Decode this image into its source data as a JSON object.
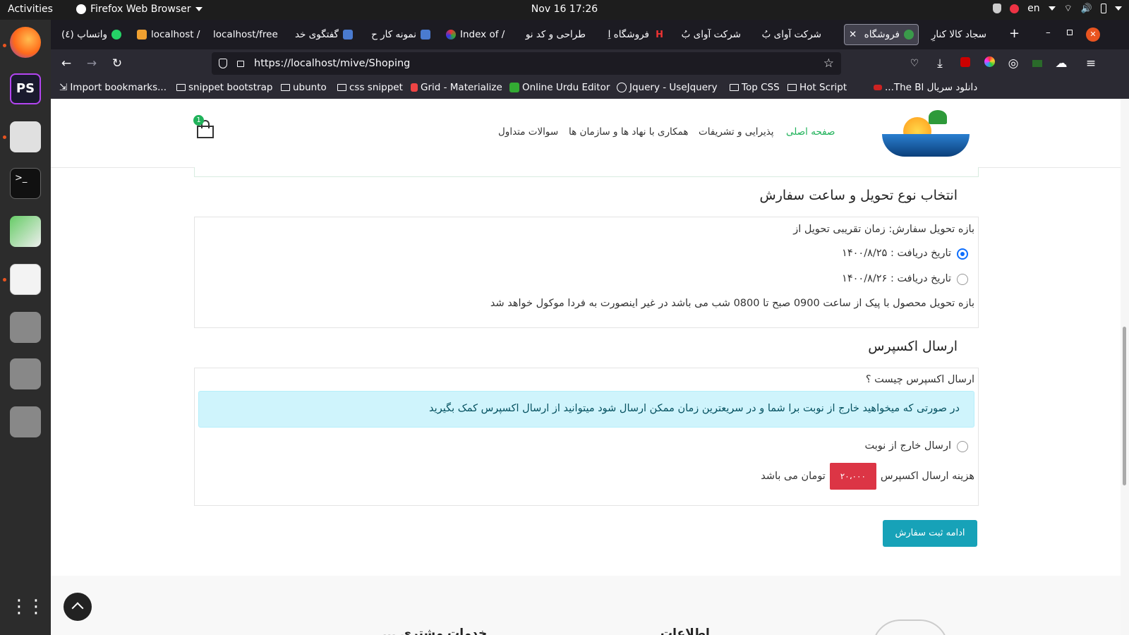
{
  "os": {
    "activities": "Activities",
    "app_name": "Firefox Web Browser",
    "clock": "Nov 16  17:26",
    "lang": "en"
  },
  "browser": {
    "tabs": [
      {
        "label": "واتساپ (٤)"
      },
      {
        "label": "localhost /"
      },
      {
        "label": "localhost/free"
      },
      {
        "label": "گفتگوی خد"
      },
      {
        "label": "نمونه کار ح"
      },
      {
        "label": "Index of /"
      },
      {
        "label": "طراحی و کد نو"
      },
      {
        "label": "فروشگاه اِ"
      },
      {
        "label": "شرکت آوای بُ"
      },
      {
        "label": "شرکت آوای بُ"
      },
      {
        "label": "فروشگاه"
      },
      {
        "label": "سجاد کالا کنارِ"
      }
    ],
    "new_tab": "+",
    "url": "https://localhost/mive/Shoping",
    "bookmarks": [
      "Import bookmarks...",
      "snippet bootstrap",
      "ubunto",
      "css snippet",
      "Grid - Materialize",
      "Online Urdu Editor",
      "Jquery - UseJquery",
      "Top CSS",
      "Hot Script",
      "دانلود سریال The Bl..."
    ]
  },
  "site": {
    "cart_count": "1",
    "menu": [
      {
        "label": "صفحه اصلی"
      },
      {
        "label": "پذیرایی و تشریفات"
      },
      {
        "label": "همکاری با نهاد ها و سازمان ها"
      },
      {
        "label": "سوالات متداول"
      }
    ]
  },
  "delivery": {
    "title": "انتخاب نوع تحویل و ساعت سفارش",
    "range_label": "بازه تحویل سفارش: زمان تقریبی تحویل از",
    "options": [
      {
        "label": "تاریخ دریافت : ۱۴۰۰/۸/۲۵",
        "checked": true
      },
      {
        "label": "تاریخ دریافت : ۱۴۰۰/۸/۲۶",
        "checked": false
      }
    ],
    "note": "بازه تحویل محصول با پیک از ساعت 0900 صبح تا 0800 شب می باشد در غیر اینصورت به فردا موکول خواهد شد"
  },
  "express": {
    "title": "ارسال اکسپرس",
    "question": "ارسال اکسپرس چیست ؟",
    "info": "در صورتی که میخواهید خارج از نوبت برا شما و در سریعترین زمان ممکن ارسال شود میتوانید از ارسال اکسپرس کمک بگیرید",
    "option": "ارسال خارج از نوبت",
    "cost_prefix": "هزینه ارسال اکسپرس",
    "cost_value": "۲۰،۰۰۰",
    "cost_suffix": "تومان می باشد"
  },
  "continue_button": "ادامه ثبت سفارش",
  "footer": {
    "heading_1": "اطلاعات",
    "heading_2": "خدمات مشتری ..."
  },
  "colors": {
    "accent_green": "#20b25a",
    "info_bg": "#cff4fc",
    "info_text": "#055160",
    "price_red": "#dc3545",
    "button_teal": "#17a2b8"
  }
}
